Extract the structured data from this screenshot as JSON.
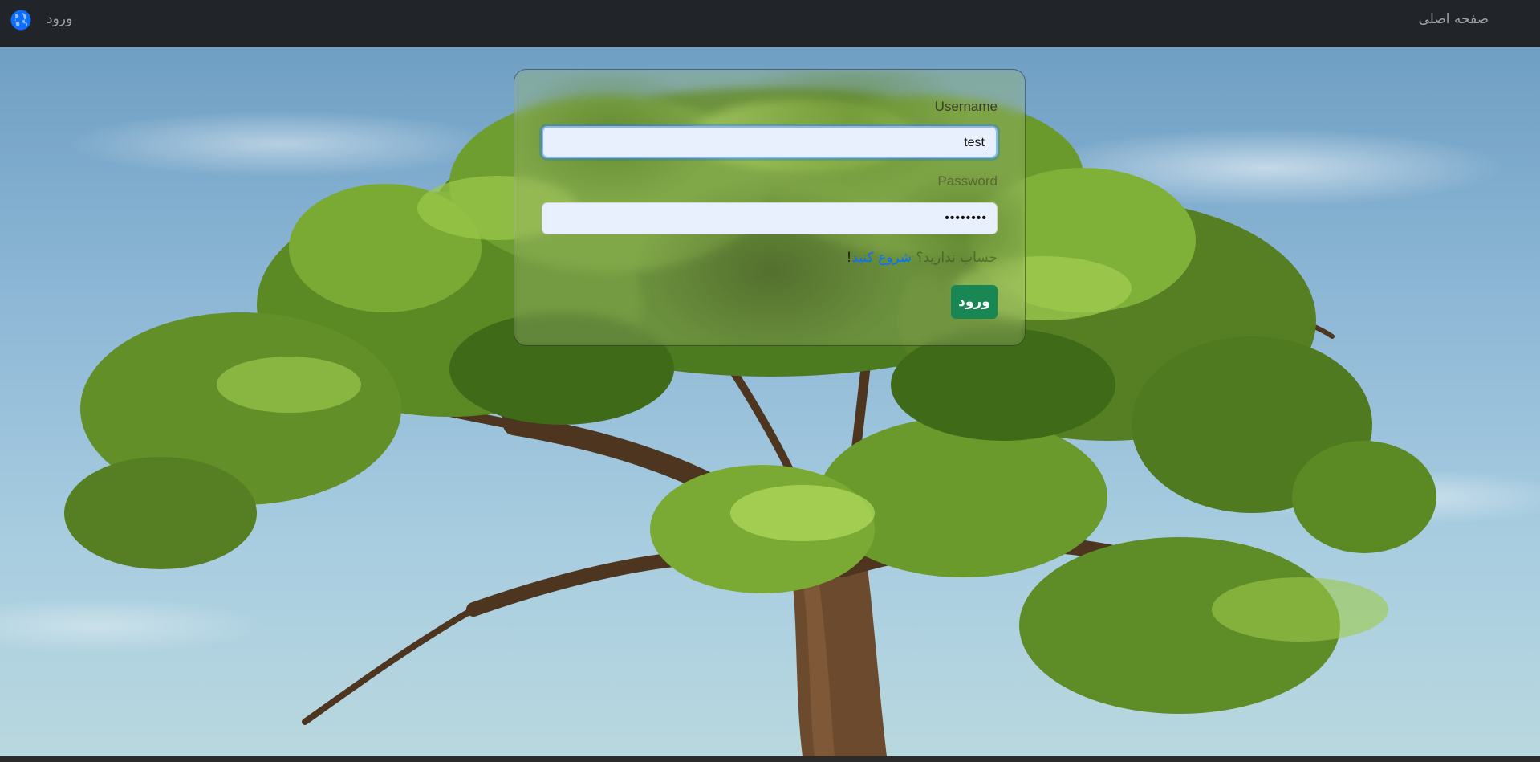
{
  "navbar": {
    "home_label": "صفحه اصلی",
    "login_label": "ورود",
    "logo_icon": "globe-icon"
  },
  "login_form": {
    "username_label": "Username",
    "username_value": "test",
    "password_label": "Password",
    "password_value": "••••••••",
    "signup_prefix": "حساب ندارید؟",
    "signup_link": "شروع کنید",
    "signup_suffix": "!",
    "submit_label": "ورود"
  },
  "colors": {
    "navbar_bg": "#212529",
    "nav_text": "#9da3a9",
    "submit_bg": "#198754",
    "link": "#0d6efd",
    "input_bg": "#e8f0fe",
    "logo": "#0d6efd"
  }
}
